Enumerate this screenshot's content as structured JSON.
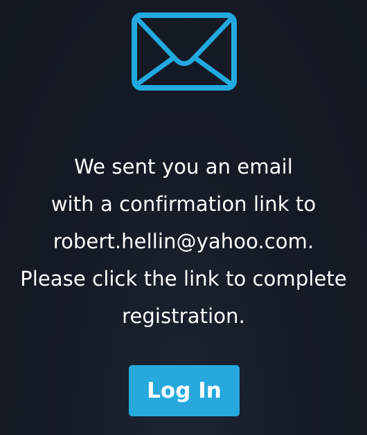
{
  "icons": {
    "envelope": "mail-envelope-icon"
  },
  "colors": {
    "background": "#131923",
    "icon_accent": "#22a9e0",
    "button_background": "#27a9de",
    "text": "#ffffff"
  },
  "message": {
    "line_1": "We sent you an email",
    "line_2": "with a confirmation link to",
    "line_3": "robert.hellin@yahoo.com.",
    "line_4": "Please click the link to complete",
    "line_5": "registration."
  },
  "actions": {
    "login_label": "Log In"
  }
}
